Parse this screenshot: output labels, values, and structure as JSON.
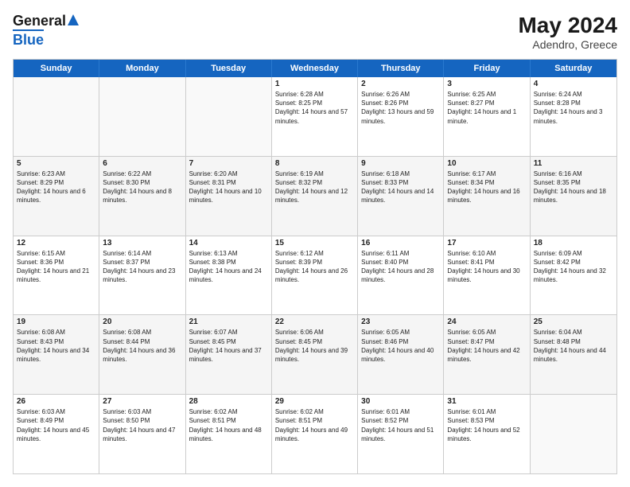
{
  "header": {
    "logo_line1": "General",
    "logo_line2": "Blue",
    "title": "May 2024",
    "subtitle": "Adendro, Greece"
  },
  "day_names": [
    "Sunday",
    "Monday",
    "Tuesday",
    "Wednesday",
    "Thursday",
    "Friday",
    "Saturday"
  ],
  "weeks": [
    [
      {
        "date": "",
        "sunrise": "",
        "sunset": "",
        "daylight": ""
      },
      {
        "date": "",
        "sunrise": "",
        "sunset": "",
        "daylight": ""
      },
      {
        "date": "",
        "sunrise": "",
        "sunset": "",
        "daylight": ""
      },
      {
        "date": "1",
        "sunrise": "Sunrise: 6:28 AM",
        "sunset": "Sunset: 8:25 PM",
        "daylight": "Daylight: 14 hours and 57 minutes."
      },
      {
        "date": "2",
        "sunrise": "Sunrise: 6:26 AM",
        "sunset": "Sunset: 8:26 PM",
        "daylight": "Daylight: 13 hours and 59 minutes."
      },
      {
        "date": "3",
        "sunrise": "Sunrise: 6:25 AM",
        "sunset": "Sunset: 8:27 PM",
        "daylight": "Daylight: 14 hours and 1 minute."
      },
      {
        "date": "4",
        "sunrise": "Sunrise: 6:24 AM",
        "sunset": "Sunset: 8:28 PM",
        "daylight": "Daylight: 14 hours and 3 minutes."
      }
    ],
    [
      {
        "date": "5",
        "sunrise": "Sunrise: 6:23 AM",
        "sunset": "Sunset: 8:29 PM",
        "daylight": "Daylight: 14 hours and 6 minutes."
      },
      {
        "date": "6",
        "sunrise": "Sunrise: 6:22 AM",
        "sunset": "Sunset: 8:30 PM",
        "daylight": "Daylight: 14 hours and 8 minutes."
      },
      {
        "date": "7",
        "sunrise": "Sunrise: 6:20 AM",
        "sunset": "Sunset: 8:31 PM",
        "daylight": "Daylight: 14 hours and 10 minutes."
      },
      {
        "date": "8",
        "sunrise": "Sunrise: 6:19 AM",
        "sunset": "Sunset: 8:32 PM",
        "daylight": "Daylight: 14 hours and 12 minutes."
      },
      {
        "date": "9",
        "sunrise": "Sunrise: 6:18 AM",
        "sunset": "Sunset: 8:33 PM",
        "daylight": "Daylight: 14 hours and 14 minutes."
      },
      {
        "date": "10",
        "sunrise": "Sunrise: 6:17 AM",
        "sunset": "Sunset: 8:34 PM",
        "daylight": "Daylight: 14 hours and 16 minutes."
      },
      {
        "date": "11",
        "sunrise": "Sunrise: 6:16 AM",
        "sunset": "Sunset: 8:35 PM",
        "daylight": "Daylight: 14 hours and 18 minutes."
      }
    ],
    [
      {
        "date": "12",
        "sunrise": "Sunrise: 6:15 AM",
        "sunset": "Sunset: 8:36 PM",
        "daylight": "Daylight: 14 hours and 21 minutes."
      },
      {
        "date": "13",
        "sunrise": "Sunrise: 6:14 AM",
        "sunset": "Sunset: 8:37 PM",
        "daylight": "Daylight: 14 hours and 23 minutes."
      },
      {
        "date": "14",
        "sunrise": "Sunrise: 6:13 AM",
        "sunset": "Sunset: 8:38 PM",
        "daylight": "Daylight: 14 hours and 24 minutes."
      },
      {
        "date": "15",
        "sunrise": "Sunrise: 6:12 AM",
        "sunset": "Sunset: 8:39 PM",
        "daylight": "Daylight: 14 hours and 26 minutes."
      },
      {
        "date": "16",
        "sunrise": "Sunrise: 6:11 AM",
        "sunset": "Sunset: 8:40 PM",
        "daylight": "Daylight: 14 hours and 28 minutes."
      },
      {
        "date": "17",
        "sunrise": "Sunrise: 6:10 AM",
        "sunset": "Sunset: 8:41 PM",
        "daylight": "Daylight: 14 hours and 30 minutes."
      },
      {
        "date": "18",
        "sunrise": "Sunrise: 6:09 AM",
        "sunset": "Sunset: 8:42 PM",
        "daylight": "Daylight: 14 hours and 32 minutes."
      }
    ],
    [
      {
        "date": "19",
        "sunrise": "Sunrise: 6:08 AM",
        "sunset": "Sunset: 8:43 PM",
        "daylight": "Daylight: 14 hours and 34 minutes."
      },
      {
        "date": "20",
        "sunrise": "Sunrise: 6:08 AM",
        "sunset": "Sunset: 8:44 PM",
        "daylight": "Daylight: 14 hours and 36 minutes."
      },
      {
        "date": "21",
        "sunrise": "Sunrise: 6:07 AM",
        "sunset": "Sunset: 8:45 PM",
        "daylight": "Daylight: 14 hours and 37 minutes."
      },
      {
        "date": "22",
        "sunrise": "Sunrise: 6:06 AM",
        "sunset": "Sunset: 8:45 PM",
        "daylight": "Daylight: 14 hours and 39 minutes."
      },
      {
        "date": "23",
        "sunrise": "Sunrise: 6:05 AM",
        "sunset": "Sunset: 8:46 PM",
        "daylight": "Daylight: 14 hours and 40 minutes."
      },
      {
        "date": "24",
        "sunrise": "Sunrise: 6:05 AM",
        "sunset": "Sunset: 8:47 PM",
        "daylight": "Daylight: 14 hours and 42 minutes."
      },
      {
        "date": "25",
        "sunrise": "Sunrise: 6:04 AM",
        "sunset": "Sunset: 8:48 PM",
        "daylight": "Daylight: 14 hours and 44 minutes."
      }
    ],
    [
      {
        "date": "26",
        "sunrise": "Sunrise: 6:03 AM",
        "sunset": "Sunset: 8:49 PM",
        "daylight": "Daylight: 14 hours and 45 minutes."
      },
      {
        "date": "27",
        "sunrise": "Sunrise: 6:03 AM",
        "sunset": "Sunset: 8:50 PM",
        "daylight": "Daylight: 14 hours and 47 minutes."
      },
      {
        "date": "28",
        "sunrise": "Sunrise: 6:02 AM",
        "sunset": "Sunset: 8:51 PM",
        "daylight": "Daylight: 14 hours and 48 minutes."
      },
      {
        "date": "29",
        "sunrise": "Sunrise: 6:02 AM",
        "sunset": "Sunset: 8:51 PM",
        "daylight": "Daylight: 14 hours and 49 minutes."
      },
      {
        "date": "30",
        "sunrise": "Sunrise: 6:01 AM",
        "sunset": "Sunset: 8:52 PM",
        "daylight": "Daylight: 14 hours and 51 minutes."
      },
      {
        "date": "31",
        "sunrise": "Sunrise: 6:01 AM",
        "sunset": "Sunset: 8:53 PM",
        "daylight": "Daylight: 14 hours and 52 minutes."
      },
      {
        "date": "",
        "sunrise": "",
        "sunset": "",
        "daylight": ""
      }
    ]
  ]
}
